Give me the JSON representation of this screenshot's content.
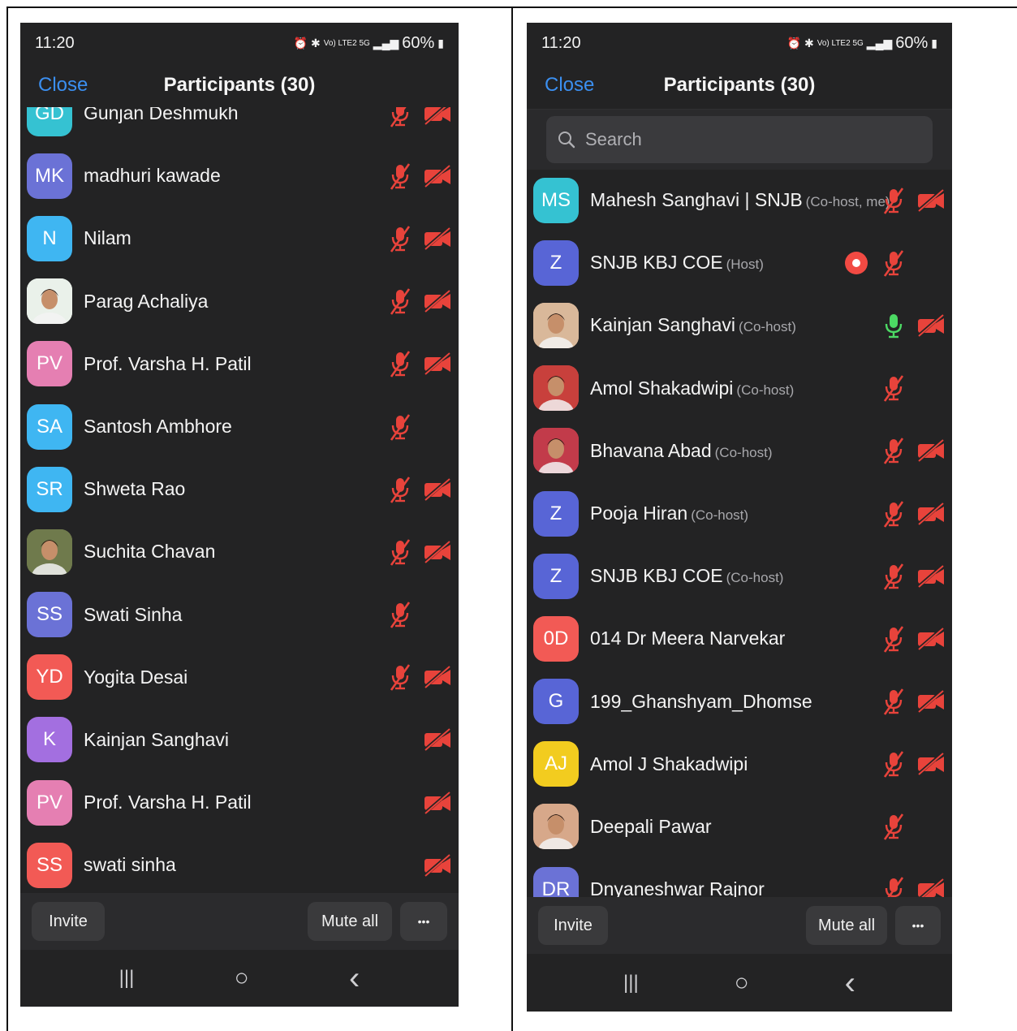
{
  "colors": {
    "muted_red": "#e8433b",
    "link_blue": "#3b8ff0",
    "live_green": "#4cd964",
    "record_red": "#f24a43"
  },
  "panels": [
    {
      "status": {
        "time": "11:20",
        "signal_text": "Vo) LTE2 5G",
        "battery": "60%"
      },
      "header": {
        "close": "Close",
        "title": "Participants (30)"
      },
      "participants": [
        {
          "initials": "GD",
          "name": "Gunjan Deshmukh",
          "role": "",
          "avatar_color": "#35c2d2",
          "photo": false,
          "mic": "muted",
          "video": "off"
        },
        {
          "initials": "MK",
          "name": "madhuri kawade",
          "role": "",
          "avatar_color": "#6b72d6",
          "photo": false,
          "mic": "muted",
          "video": "off"
        },
        {
          "initials": "N",
          "name": "Nilam",
          "role": "",
          "avatar_color": "#3fb6f2",
          "photo": false,
          "mic": "muted",
          "video": "off"
        },
        {
          "initials": "",
          "name": "Parag Achaliya",
          "role": "",
          "avatar_color": "#eaf1ea",
          "photo": true,
          "mic": "muted",
          "video": "off"
        },
        {
          "initials": "PV",
          "name": "Prof. Varsha H. Patil",
          "role": "",
          "avatar_color": "#e57fb2",
          "photo": false,
          "mic": "muted",
          "video": "off"
        },
        {
          "initials": "SA",
          "name": "Santosh Ambhore",
          "role": "",
          "avatar_color": "#3fb6f2",
          "photo": false,
          "mic": "muted",
          "video": "none"
        },
        {
          "initials": "SR",
          "name": "Shweta Rao",
          "role": "",
          "avatar_color": "#3fb6f2",
          "photo": false,
          "mic": "muted",
          "video": "off"
        },
        {
          "initials": "",
          "name": "Suchita Chavan",
          "role": "",
          "avatar_color": "#6f7a4c",
          "photo": true,
          "mic": "muted",
          "video": "off"
        },
        {
          "initials": "SS",
          "name": "Swati Sinha",
          "role": "",
          "avatar_color": "#6b72d6",
          "photo": false,
          "mic": "muted",
          "video": "none"
        },
        {
          "initials": "YD",
          "name": "Yogita Desai",
          "role": "",
          "avatar_color": "#f25a55",
          "photo": false,
          "mic": "muted",
          "video": "off"
        },
        {
          "initials": "K",
          "name": "Kainjan  Sanghavi",
          "role": "",
          "avatar_color": "#a36fe0",
          "photo": false,
          "mic": "none",
          "video": "off"
        },
        {
          "initials": "PV",
          "name": "Prof. Varsha H. Patil",
          "role": "",
          "avatar_color": "#e57fb2",
          "photo": false,
          "mic": "none",
          "video": "off"
        },
        {
          "initials": "SS",
          "name": "swati sinha",
          "role": "",
          "avatar_color": "#f25a55",
          "photo": false,
          "mic": "none",
          "video": "off"
        }
      ],
      "footer": {
        "invite": "Invite",
        "mute_all": "Mute all",
        "more": "•••"
      },
      "nav": {
        "recents": "|||",
        "home": "○",
        "back": "‹"
      }
    },
    {
      "status": {
        "time": "11:20",
        "signal_text": "Vo) LTE2 5G",
        "battery": "60%"
      },
      "header": {
        "close": "Close",
        "title": "Participants (30)"
      },
      "search": {
        "placeholder": "Search"
      },
      "participants": [
        {
          "initials": "MS",
          "name": "Mahesh Sanghavi | SNJB",
          "role": "(Co-host, me)",
          "avatar_color": "#35c2d2",
          "photo": false,
          "mic": "muted",
          "video": "off"
        },
        {
          "initials": "Z",
          "name": "SNJB KBJ COE",
          "role": "(Host)",
          "avatar_color": "#5865d6",
          "photo": false,
          "mic": "muted",
          "video": "record"
        },
        {
          "initials": "",
          "name": "Kainjan Sanghavi",
          "role": "(Co-host)",
          "avatar_color": "#d9b89a",
          "photo": true,
          "mic": "live",
          "video": "off"
        },
        {
          "initials": "",
          "name": "Amol Shakadwipi",
          "role": "(Co-host)",
          "avatar_color": "#c8403c",
          "photo": true,
          "mic": "muted",
          "video": "none"
        },
        {
          "initials": "",
          "name": "Bhavana Abad",
          "role": "(Co-host)",
          "avatar_color": "#c23b4a",
          "photo": true,
          "mic": "muted",
          "video": "off"
        },
        {
          "initials": "Z",
          "name": "Pooja Hiran",
          "role": "(Co-host)",
          "avatar_color": "#5865d6",
          "photo": false,
          "mic": "muted",
          "video": "off"
        },
        {
          "initials": "Z",
          "name": "SNJB KBJ COE",
          "role": "(Co-host)",
          "avatar_color": "#5865d6",
          "photo": false,
          "mic": "muted",
          "video": "off"
        },
        {
          "initials": "0D",
          "name": "014 Dr Meera Narvekar",
          "role": "",
          "avatar_color": "#f25a55",
          "photo": false,
          "mic": "muted",
          "video": "off"
        },
        {
          "initials": "G",
          "name": "199_Ghanshyam_Dhomse",
          "role": "",
          "avatar_color": "#5865d6",
          "photo": false,
          "mic": "muted",
          "video": "off"
        },
        {
          "initials": "AJ",
          "name": "Amol J Shakadwipi",
          "role": "",
          "avatar_color": "#f2cc1f",
          "photo": false,
          "mic": "muted",
          "video": "off"
        },
        {
          "initials": "",
          "name": "Deepali Pawar",
          "role": "",
          "avatar_color": "#d7a88a",
          "photo": true,
          "mic": "muted",
          "video": "none"
        },
        {
          "initials": "DR",
          "name": "Dnyaneshwar Rajnor",
          "role": "",
          "avatar_color": "#6b72d6",
          "photo": false,
          "mic": "muted",
          "video": "off"
        }
      ],
      "footer": {
        "invite": "Invite",
        "mute_all": "Mute all",
        "more": "•••"
      },
      "nav": {
        "recents": "|||",
        "home": "○",
        "back": "‹"
      }
    }
  ]
}
